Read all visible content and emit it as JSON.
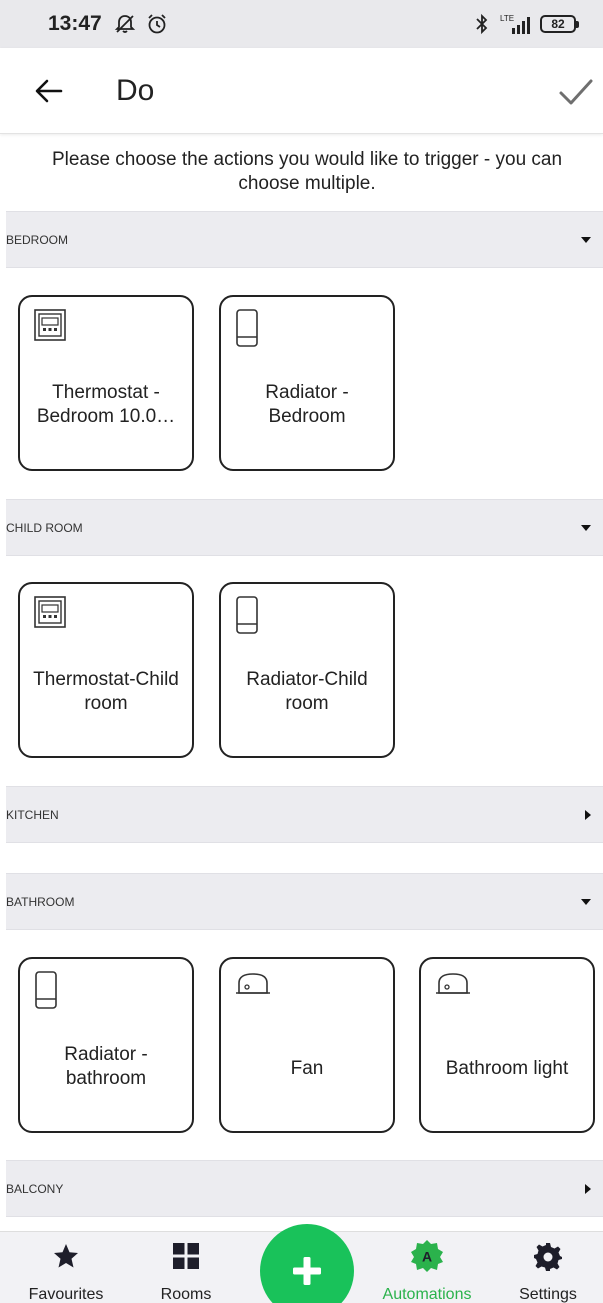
{
  "status_bar": {
    "time": "13:47",
    "network": "LTE",
    "battery": "82",
    "icons": [
      "notifications-off-icon",
      "alarm-icon",
      "bluetooth-icon",
      "signal-icon",
      "battery-icon"
    ]
  },
  "header": {
    "title": "Do",
    "back_icon": "back-arrow-icon",
    "confirm_icon": "check-icon"
  },
  "instruction": "Please choose the actions you would like to trigger - you can choose multiple.",
  "sections": [
    {
      "label": "BEDROOM",
      "expanded": true,
      "devices": [
        {
          "name": "Thermostat - Bedroom 10.0…",
          "icon": "thermostat-icon"
        },
        {
          "name": "Radiator - Bedroom",
          "icon": "radiator-icon"
        }
      ]
    },
    {
      "label": "CHILD ROOM",
      "expanded": true,
      "devices": [
        {
          "name": "Thermostat-Child room",
          "icon": "thermostat-icon"
        },
        {
          "name": "Radiator-Child room",
          "icon": "radiator-icon"
        }
      ]
    },
    {
      "label": "KITCHEN",
      "expanded": false,
      "devices": []
    },
    {
      "label": "BATHROOM",
      "expanded": true,
      "devices": [
        {
          "name": "Radiator - bathroom",
          "icon": "radiator-icon"
        },
        {
          "name": "Fan",
          "icon": "plug-icon"
        },
        {
          "name": "Bathroom light",
          "icon": "plug-icon"
        }
      ]
    },
    {
      "label": "BALCONY",
      "expanded": false,
      "devices": []
    }
  ],
  "bottom_nav": {
    "items": [
      {
        "label": "Favourites",
        "icon": "star-icon"
      },
      {
        "label": "Rooms",
        "icon": "grid-icon"
      },
      {
        "label": "Automations",
        "icon": "automations-badge-icon",
        "active": true
      },
      {
        "label": "Settings",
        "icon": "gear-icon"
      }
    ],
    "fab_icon": "plus-icon",
    "active_color": "#2bb24c"
  },
  "colors": {
    "accent": "#19c25a",
    "section_bg": "#ececf0",
    "status_bar_bg": "#e9e9ec"
  }
}
